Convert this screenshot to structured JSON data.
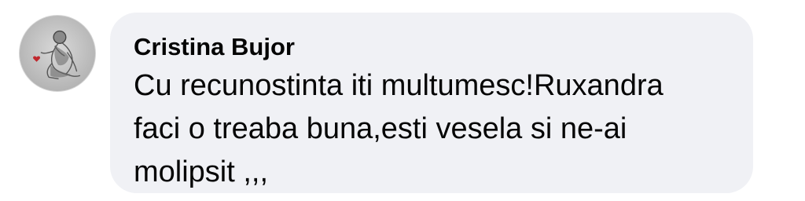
{
  "comment": {
    "author": "Cristina Bujor",
    "line1": "Cu recunostinta iti multumesc!Ruxandra",
    "line2": "faci o treaba buna,esti vesela si ne-ai",
    "line3": "molipsit ,,,"
  },
  "avatar": {
    "icon": "profile-photo-icon",
    "accent_color": "#c0282d"
  },
  "colors": {
    "bubble": "#f0f1f5",
    "text": "#050505"
  }
}
